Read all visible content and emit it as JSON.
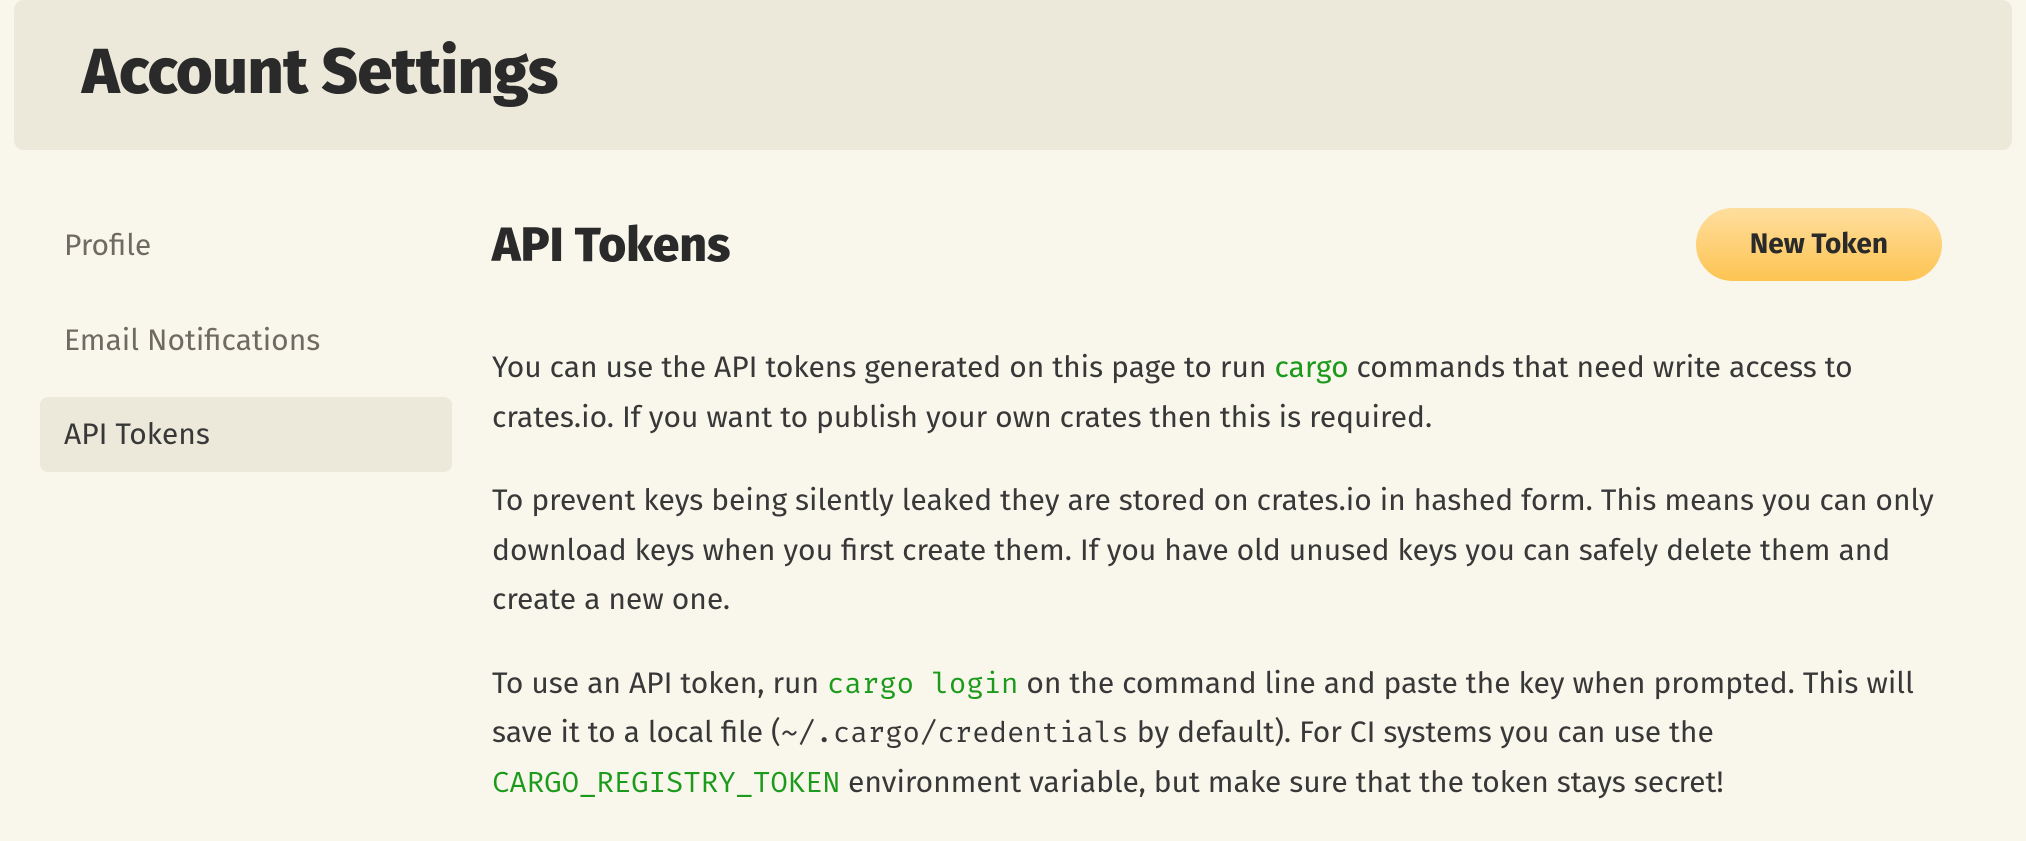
{
  "header": {
    "title": "Account Settings"
  },
  "sidebar": {
    "items": [
      {
        "label": "Profile",
        "active": false
      },
      {
        "label": "Email Notifications",
        "active": false
      },
      {
        "label": "API Tokens",
        "active": true
      }
    ]
  },
  "main": {
    "title": "API Tokens",
    "new_token_label": "New Token",
    "p1_a": "You can use the API tokens generated on this page to run ",
    "p1_link": "cargo",
    "p1_b": " commands that need write access to crates.io. If you want to publish your own crates then this is required.",
    "p2": "To prevent keys being silently leaked they are stored on crates.io in hashed form. This means you can only download keys when you first create them. If you have old unused keys you can safely delete them and create a new one.",
    "p3_a": "To use an API token, run ",
    "p3_code1": "cargo login",
    "p3_b": " on the command line and paste the key when prompted. This will save it to a local file (",
    "p3_code2": "~/.cargo/credentials",
    "p3_c": " by default). For CI systems you can use the ",
    "p3_code3": "CARGO_REGISTRY_TOKEN",
    "p3_d": " environment variable, but make sure that the token stays secret!"
  }
}
